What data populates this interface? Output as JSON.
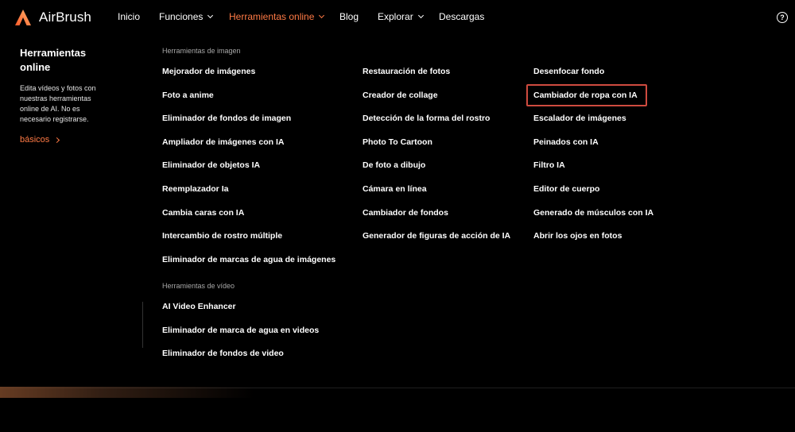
{
  "brand": {
    "name": "AirBrush",
    "accent": "#ff7a45"
  },
  "nav": {
    "items": [
      {
        "label": "Inicio",
        "dropdown": false,
        "active": false
      },
      {
        "label": "Funciones",
        "dropdown": true,
        "active": false
      },
      {
        "label": "Herramientas online",
        "dropdown": true,
        "active": true
      },
      {
        "label": "Blog",
        "dropdown": false,
        "active": false
      },
      {
        "label": "Explorar",
        "dropdown": true,
        "active": false
      },
      {
        "label": "Descargas",
        "dropdown": false,
        "active": false
      }
    ],
    "help_symbol": "?"
  },
  "sidebar": {
    "title": "Herramientas online",
    "description": "Edita vídeos y fotos con nuestras herramientas online de AI. No es necesario registrarse.",
    "link": "básicos"
  },
  "sections": {
    "image_label": "Herramientas de imagen",
    "video_label": "Herramientas de vídeo"
  },
  "image_tools": {
    "col1": [
      "Mejorador de imágenes",
      "Foto a anime",
      "Eliminador de fondos de imagen",
      "Ampliador de imágenes con IA",
      "Eliminador de objetos IA",
      "Reemplazador Ia",
      "Cambia caras con IA",
      "Intercambio de rostro múltiple",
      "Eliminador de marcas de agua de imágenes"
    ],
    "col2": [
      "Restauración de fotos",
      "Creador de collage",
      "Detección de la forma del rostro",
      "Photo To Cartoon",
      "De foto a dibujo",
      "Cámara en línea",
      "Cambiador de fondos",
      "Generador de figuras de acción de IA"
    ],
    "col3": [
      "Desenfocar fondo",
      "Cambiador de ropa con IA",
      "Escalador de imágenes",
      "Peinados con IA",
      "Filtro IA",
      "Editor de cuerpo",
      "Generado de músculos con IA",
      "Abrir los ojos en fotos"
    ]
  },
  "video_tools": [
    "AI Video Enhancer",
    "Eliminador de marca de agua en videos",
    "Eliminador de fondos de video"
  ],
  "highlighted_item": "Cambiador de ropa con IA",
  "highlight_color": "#cf4b3f"
}
